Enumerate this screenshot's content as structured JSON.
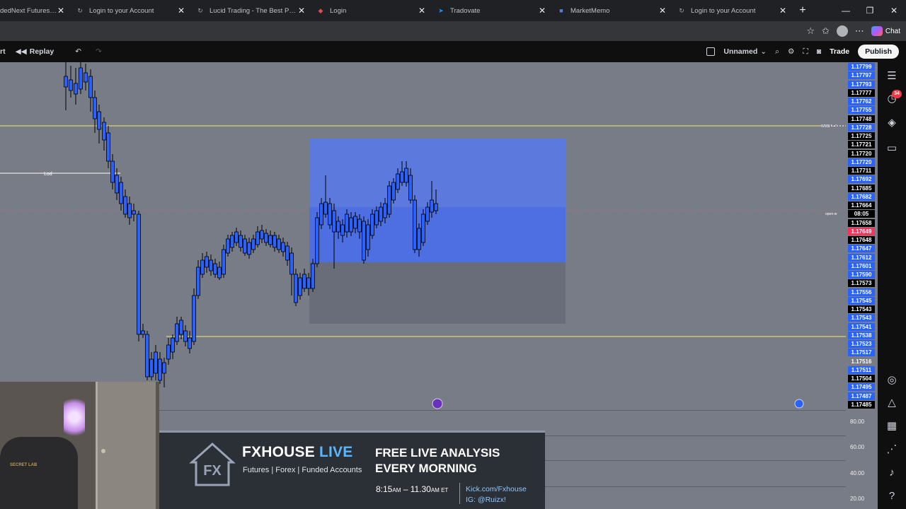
{
  "browser": {
    "tabs": [
      {
        "title": "dedNext Futures Hel",
        "favicon": "help-icon",
        "fav_color": "#8ab4f8"
      },
      {
        "title": "Login to your Account",
        "favicon": "swirl-icon",
        "fav_color": "#9aa0a6"
      },
      {
        "title": "Lucid Trading - The Best Prop Fi",
        "favicon": "swirl-icon",
        "fav_color": "#9aa0a6"
      },
      {
        "title": "Login",
        "favicon": "shield-icon",
        "fav_color": "#e04a5f"
      },
      {
        "title": "Tradovate",
        "favicon": "tradovate-icon",
        "fav_color": "#1e90ff"
      },
      {
        "title": "MarketMemo",
        "favicon": "memo-icon",
        "fav_color": "#5b7bd6"
      },
      {
        "title": "Login to your Account",
        "favicon": "swirl-icon",
        "fav_color": "#9aa0a6"
      }
    ],
    "chat_label": "Chat"
  },
  "toolbar": {
    "left_partial": "rt",
    "replay_label": "Replay",
    "layout_name": "Unnamed",
    "trade_label": "Trade",
    "publish_label": "Publish"
  },
  "price_scale": {
    "labels": [
      {
        "text": "1.17799",
        "bg": "#2962ff"
      },
      {
        "text": "1.17797",
        "bg": "#2962ff"
      },
      {
        "text": "1.17793",
        "bg": "#2962ff"
      },
      {
        "text": "1.17777",
        "bg": "#000000"
      },
      {
        "text": "1.17762",
        "bg": "#2962ff"
      },
      {
        "text": "1.17755",
        "bg": "#2962ff"
      },
      {
        "text": "1.17748",
        "bg": "#000000"
      },
      {
        "text": "1.17728",
        "bg": "#2962ff"
      },
      {
        "text": "1.17725",
        "bg": "#000000"
      },
      {
        "text": "1.17721",
        "bg": "#000000"
      },
      {
        "text": "1.17720",
        "bg": "#000000"
      },
      {
        "text": "1.17720",
        "bg": "#2962ff"
      },
      {
        "text": "1.17711",
        "bg": "#000000"
      },
      {
        "text": "1.17692",
        "bg": "#2962ff"
      },
      {
        "text": "1.17685",
        "bg": "#000000"
      },
      {
        "text": "1.17682",
        "bg": "#2962ff"
      },
      {
        "text": "1.17664",
        "bg": "#000000"
      },
      {
        "text": "08:05",
        "bg": "#000000"
      },
      {
        "text": "1.17658",
        "bg": "#000000"
      },
      {
        "text": "1.17649",
        "bg": "#f2365e"
      },
      {
        "text": "1.17648",
        "bg": "#000000"
      },
      {
        "text": "1.17647",
        "bg": "#2962ff"
      },
      {
        "text": "1.17612",
        "bg": "#2962ff"
      },
      {
        "text": "1.17601",
        "bg": "#2962ff"
      },
      {
        "text": "1.17590",
        "bg": "#2962ff"
      },
      {
        "text": "1.17573",
        "bg": "#000000"
      },
      {
        "text": "1.17556",
        "bg": "#2962ff"
      },
      {
        "text": "1.17545",
        "bg": "#2962ff"
      },
      {
        "text": "1.17543",
        "bg": "#000000"
      },
      {
        "text": "1.17543",
        "bg": "#2962ff"
      },
      {
        "text": "1.17541",
        "bg": "#2962ff"
      },
      {
        "text": "1.17538",
        "bg": "#2962ff"
      },
      {
        "text": "1.17523",
        "bg": "#2962ff"
      },
      {
        "text": "1.17517",
        "bg": "#2962ff"
      },
      {
        "text": "1.17516",
        "bg": "#787c86"
      },
      {
        "text": "1.17511",
        "bg": "#2962ff"
      },
      {
        "text": "1.17504",
        "bg": "#000000"
      },
      {
        "text": "1.17495",
        "bg": "#2962ff"
      },
      {
        "text": "1.17487",
        "bg": "#2962ff"
      },
      {
        "text": "1.17485",
        "bg": "#000000"
      }
    ]
  },
  "chart_labels": {
    "lod": "Lod",
    "wms": "WMS \"---\"",
    "open_w": "open-w"
  },
  "oscillator": {
    "labels": [
      "80.00",
      "60.00",
      "40.00",
      "20.00"
    ]
  },
  "sidebar": {
    "badge": "34"
  },
  "webcam": {
    "chair_text": "SECRET LAB"
  },
  "banner": {
    "brand": "FXHOUSE",
    "brand_live": "LIVE",
    "subtitle": "Futures | Forex | Funded Accounts",
    "headline_1": "FREE LIVE ANALYSIS",
    "headline_2": "EVERY MORNING",
    "time_start": "8:15",
    "time_start_ampm": "AM",
    "time_sep": " – ",
    "time_end": "11.30",
    "time_end_ampm": "AM",
    "time_zone": " ET",
    "link_kick": "Kick.com/Fxhouse",
    "link_ig": "IG: @Ruizx!"
  },
  "colors": {
    "chart_bg": "#787c86",
    "candle": "#2962ff",
    "wick": "#000000",
    "zone_blue": "#5b7cf0",
    "level_line": "#f5e663"
  }
}
